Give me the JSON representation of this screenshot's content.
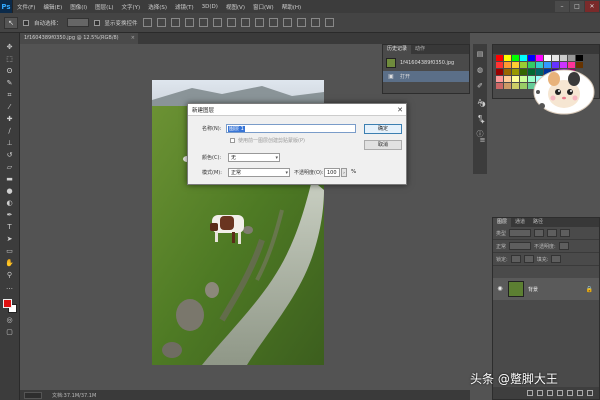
{
  "menubar": {
    "logo": "Ps",
    "items": [
      "文件(F)",
      "编辑(E)",
      "图像(I)",
      "图层(L)",
      "文字(Y)",
      "选择(S)",
      "滤镜(T)",
      "3D(D)",
      "视图(V)",
      "窗口(W)",
      "帮助(H)"
    ],
    "minimize": "–",
    "maximize": "□",
    "close": "✕"
  },
  "options": {
    "tool_icon": "↖",
    "auto_select": "自动选择：",
    "show_transform": "显示变换控件"
  },
  "tabs": {
    "document_tab": "1f1604389f0350.jpg @ 12.5%(RGB/8)",
    "close": "×"
  },
  "status": {
    "doc_info": "文档:37.1M/37.1M"
  },
  "history": {
    "tabs": [
      "历史记录",
      "动作"
    ],
    "rows": [
      {
        "label": "1f41604389f0350.jpg"
      },
      {
        "label": "打开"
      }
    ]
  },
  "dialog": {
    "title": "新建图层",
    "close": "✕",
    "name_label": "名称(N):",
    "name_value": "图层 1",
    "clipping_label": "使用前一图层创建剪贴蒙版(P)",
    "color_label": "颜色(C):",
    "color_value": "无",
    "mode_label": "模式(M):",
    "mode_value": "正常",
    "opacity_label": "不透明度(O):",
    "opacity_value": "100",
    "opacity_unit": "%",
    "ok_label": "确定",
    "cancel_label": "取消"
  },
  "layers": {
    "tabs": [
      "图层",
      "通道",
      "路径"
    ],
    "filter_kind": "类型",
    "mode": "正常",
    "opacity_label": "不透明度:",
    "lock_label": "锁定:",
    "fill_label": "填充:",
    "layer_name": "背景"
  },
  "swatches": {
    "colors": [
      "#ff0000",
      "#ffff00",
      "#00ff00",
      "#00ffff",
      "#0000ff",
      "#ff00ff",
      "#ffffff",
      "#e6e6e6",
      "#cccccc",
      "#999999",
      "#000000",
      "#ff3333",
      "#ff9933",
      "#ffcc33",
      "#99cc33",
      "#33cc66",
      "#33cccc",
      "#3399ff",
      "#6633ff",
      "#cc33ff",
      "#ff3399",
      "#663300",
      "#990000",
      "#996600",
      "#999900",
      "#336600",
      "#006633",
      "#006666",
      "#003399",
      "#330099",
      "#660099",
      "#990066",
      "#4d4d4d",
      "#ff9999",
      "#ffcc99",
      "#ffff99",
      "#ccff99",
      "#99ffcc",
      "#99ffff",
      "#99ccff",
      "#cc99ff",
      "#ff99ff",
      "#ff99cc",
      "#b3b3b3",
      "#cc6666",
      "#cc9966",
      "#cccc66",
      "#99cc66",
      "#66cc99",
      "#66cccc",
      "#6699cc",
      "#9966cc",
      "#cc66cc",
      "#cc6699",
      "#808080"
    ]
  },
  "watermark": "头条 @蹩脚大王"
}
